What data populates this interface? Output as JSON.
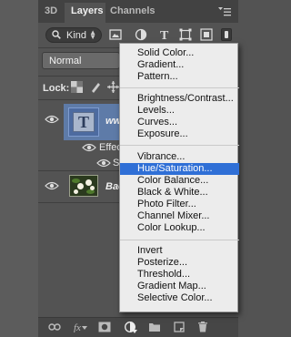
{
  "tabs": [
    {
      "label": "3D"
    },
    {
      "label": "Layers"
    },
    {
      "label": "Channels"
    }
  ],
  "filter": {
    "kind_label": "Kind"
  },
  "blend_mode": "Normal",
  "lock_label": "Lock:",
  "layers": [
    {
      "name_fragment": "ww",
      "sub_items": [
        "Effec",
        "S"
      ]
    },
    {
      "name_fragment": "Bac"
    }
  ],
  "menu": {
    "groups": [
      [
        "Solid Color...",
        "Gradient...",
        "Pattern..."
      ],
      [
        "Brightness/Contrast...",
        "Levels...",
        "Curves...",
        "Exposure..."
      ],
      [
        "Vibrance...",
        "Hue/Saturation...",
        "Color Balance...",
        "Black & White...",
        "Photo Filter...",
        "Channel Mixer...",
        "Color Lookup..."
      ],
      [
        "Invert",
        "Posterize...",
        "Threshold...",
        "Gradient Map...",
        "Selective Color..."
      ]
    ],
    "highlighted": "Hue/Saturation..."
  },
  "colors": {
    "panel_bg": "#535353",
    "selection": "#5e7ba8",
    "menu_highlight": "#2f6fd6",
    "menu_bg": "#ececec"
  }
}
